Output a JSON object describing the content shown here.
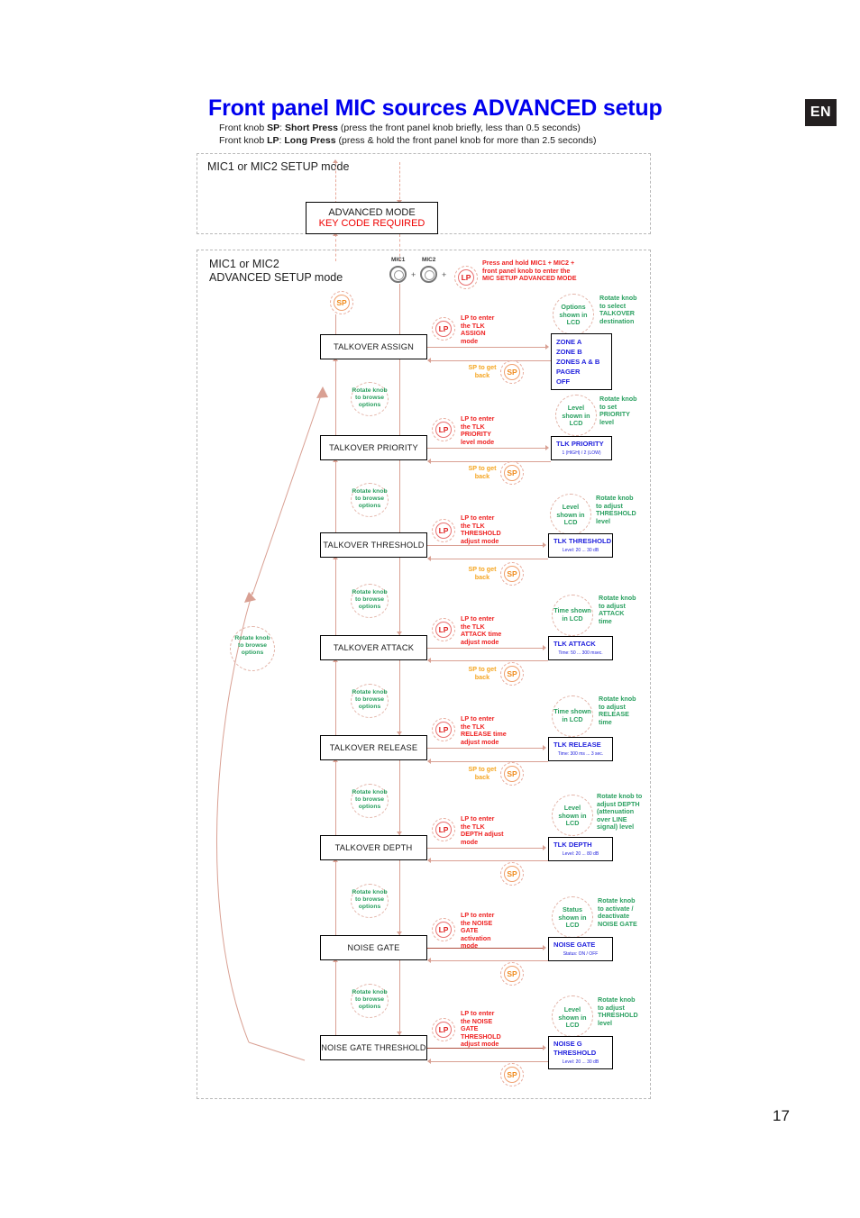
{
  "page": {
    "title": "Front panel MIC sources ADVANCED setup",
    "lang_badge": "EN",
    "page_number": "17"
  },
  "legend": [
    {
      "prefix": "Front knob",
      "code": "SP",
      "name": "Short Press",
      "desc": "(press the front panel knob briefly, less than 0.5 seconds)"
    },
    {
      "prefix": "Front knob",
      "code": "LP",
      "name": "Long Press",
      "desc": "(press & hold the front panel knob for more than 2.5 seconds)"
    }
  ],
  "regions": {
    "setup_mode_label": "MIC1 or MIC2 SETUP mode",
    "advanced_mode_label": "MIC1 or MIC2\nADVANCED SETUP mode"
  },
  "advanced_box": {
    "line1": "ADVANCED MODE",
    "line2": "KEY CODE REQUIRED"
  },
  "entry": {
    "mic1_label": "MIC1",
    "mic2_label": "MIC2",
    "plus": "+",
    "token": "LP",
    "instruction": "Press and hold MIC1 + MIC2 +\nfront panel knob to enter the\nMIC SETUP ADVANCED MODE"
  },
  "tokens": {
    "sp": "SP",
    "lp": "LP"
  },
  "common": {
    "rotate_browse": "Rotate knob\nto browse\noptions",
    "sp_get_back": "SP to get\nback",
    "big_rotate": "Rotate knob\nto browse\noptions"
  },
  "steps": [
    {
      "id": "talkover-assign",
      "name": "TALKOVER ASSIGN",
      "lp_text": "LP to enter\nthe TLK\nASSIGN\nmode",
      "lcd_text": "Options\nshown in\nLCD",
      "rotate_text": "Rotate knob\nto select\nTALKOVER\ndestination",
      "value_title": "",
      "value_sub": "",
      "options": [
        "ZONE A",
        "ZONE B",
        "ZONES A & B",
        "PAGER",
        "OFF"
      ]
    },
    {
      "id": "talkover-priority",
      "name": "TALKOVER PRIORITY",
      "lp_text": "LP to enter\nthe TLK\nPRIORITY\nlevel mode",
      "lcd_text": "Level\nshown in\nLCD",
      "rotate_text": "Rotate knob\nto set\nPRIORITY\nlevel",
      "value_title": "TLK PRIORITY",
      "value_sub": "1 (HIGH)  /  2 (LOW)",
      "options": []
    },
    {
      "id": "talkover-threshold",
      "name": "TALKOVER THRESHOLD",
      "lp_text": "LP to enter\nthe TLK\nTHRESHOLD\nadjust mode",
      "lcd_text": "Level\nshown in\nLCD",
      "rotate_text": "Rotate knob\nto adjust\nTHRESHOLD\nlevel",
      "value_title": "TLK THRESHOLD",
      "value_sub": "Level: 20  ...  30 dB",
      "options": []
    },
    {
      "id": "talkover-attack",
      "name": "TALKOVER ATTACK",
      "lp_text": "LP to enter\nthe TLK\nATTACK time\nadjust mode",
      "lcd_text": "Time shown\nin LCD",
      "rotate_text": "Rotate knob\nto adjust\nATTACK\ntime",
      "value_title": "TLK ATTACK",
      "value_sub": "Time: 50  ...  300 msec.",
      "options": []
    },
    {
      "id": "talkover-release",
      "name": "TALKOVER RELEASE",
      "lp_text": "LP to enter\nthe TLK\nRELEASE time\nadjust mode",
      "lcd_text": "Time shown\nin LCD",
      "rotate_text": "Rotate knob\nto adjust\nRELEASE\ntime",
      "value_title": "TLK RELEASE",
      "value_sub": "Time: 300 ms ... 3 sec.",
      "options": []
    },
    {
      "id": "talkover-depth",
      "name": "TALKOVER DEPTH",
      "lp_text": "LP to enter\nthe TLK\nDEPTH adjust\nmode",
      "lcd_text": "Level\nshown in\nLCD",
      "rotate_text": "Rotate knob to\nadjust DEPTH\n(attenuation\nover LINE\nsignal) level",
      "value_title": "TLK DEPTH",
      "value_sub": "Level: 20  ...  80 dB",
      "options": []
    },
    {
      "id": "noise-gate",
      "name": "NOISE GATE",
      "lp_text": "LP to enter\nthe NOISE\nGATE\nactivation\nmode",
      "lcd_text": "Status\nshown in\nLCD",
      "rotate_text": "Rotate knob\nto activate /\ndeactivate\nNOISE GATE",
      "value_title": "NOISE GATE",
      "value_sub": "Status:  ON  /  OFF",
      "options": []
    },
    {
      "id": "noise-gate-threshold",
      "name": "NOISE GATE THRESHOLD",
      "lp_text": "LP to enter\nthe NOISE\nGATE\nTHRESHOLD\nadjust mode",
      "lcd_text": "Level\nshown in\nLCD",
      "rotate_text": "Rotate knob\nto adjust\nTHRESHOLD\nlevel",
      "value_title": "NOISE G\nTHRESHOLD",
      "value_sub": "Level: 20  ...  30 dB",
      "options": []
    }
  ],
  "colors": {
    "title": "#0000ee",
    "red": "#ee2222",
    "orange": "#f5a623",
    "green": "#2aa060",
    "blue_value": "#2222dd",
    "connector": "#d9a093"
  }
}
